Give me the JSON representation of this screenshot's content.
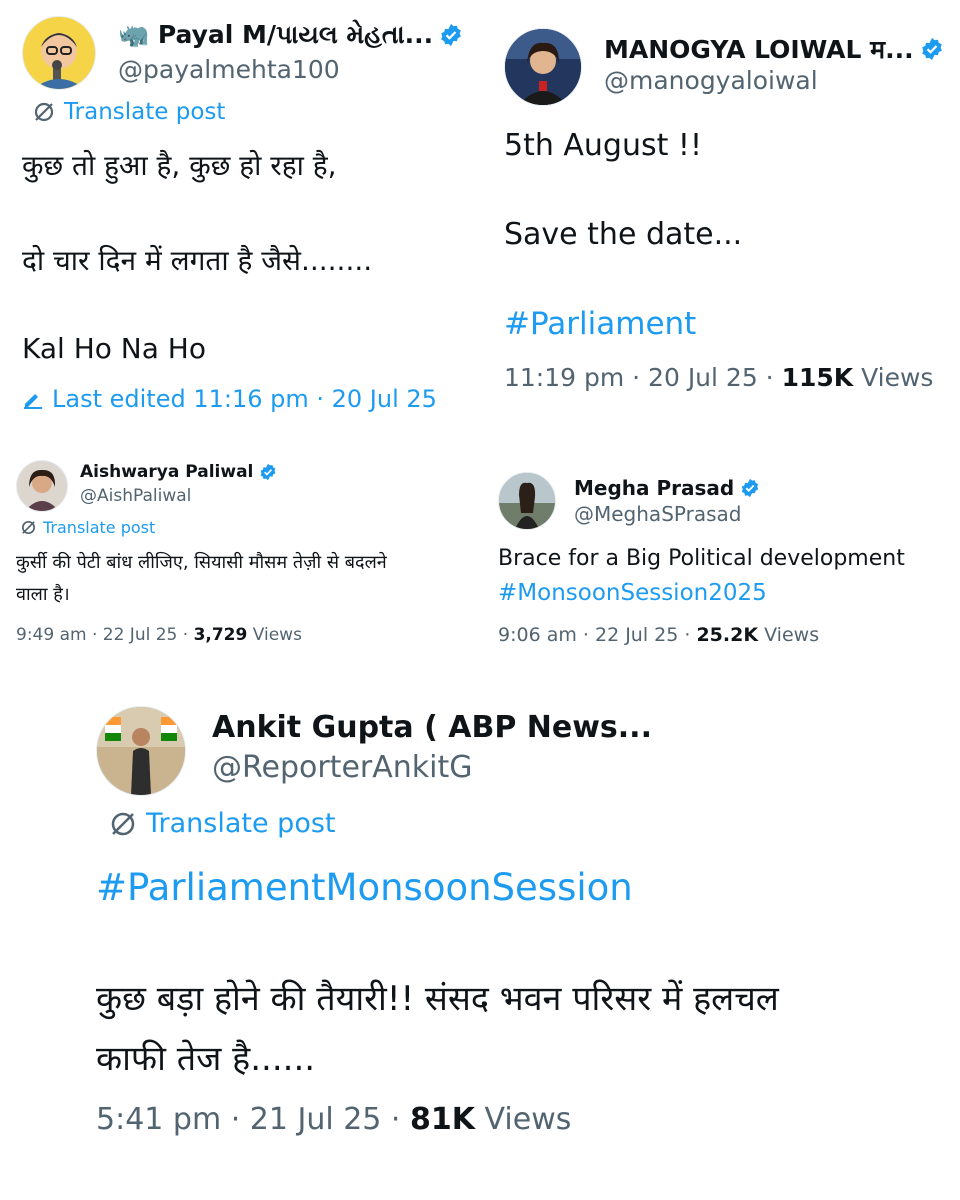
{
  "colors": {
    "link": "#1d9bf0",
    "text": "#0f1419",
    "muted": "#536471",
    "verified": "#1d9bf0"
  },
  "tweets": [
    {
      "name": "🦏 Payal M/પાયલ મેહતા...",
      "handle": "@payalmehta100",
      "translate": "Translate post",
      "lines": [
        "कुछ तो हुआ है, कुछ हो रहा है,",
        "दो चार दिन में लगता है जैसे........",
        "Kal Ho Na Ho"
      ],
      "edited": "Last edited 11:16 pm · 20 Jul 25",
      "icons": [
        "avatar-cartoon",
        "verified-badge-icon",
        "translate-icon",
        "edit-pencil-icon"
      ]
    },
    {
      "name": "MANOGYA LOIWAL म...",
      "handle": "@manogyaloiwal",
      "lines": [
        "5th August !!",
        "Save the date..."
      ],
      "hashtag": "#Parliament",
      "time": "11:19 pm · 20 Jul 25 · ",
      "views_count": "115K",
      "views_label": " Views"
    },
    {
      "name": "Aishwarya Paliwal",
      "handle": "@AishPaliwal",
      "translate": "Translate post",
      "lines": [
        "कुर्सी की पेटी बांध लीजिए, सियासी मौसम तेज़ी से बदलने",
        "वाला है।"
      ],
      "time": "9:49 am · 22 Jul 25 · ",
      "views_count": "3,729",
      "views_label": " Views"
    },
    {
      "name": "Megha Prasad",
      "handle": "@MeghaSPrasad",
      "lines": [
        "Brace for a Big Political development"
      ],
      "hashtag": "#MonsoonSession2025",
      "time": "9:06 am · 22 Jul 25 · ",
      "views_count": "25.2K",
      "views_label": " Views"
    },
    {
      "name": "Ankit Gupta ( ABP News...",
      "handle": "@ReporterAnkitG",
      "translate": "Translate post",
      "hashtag": "#ParliamentMonsoonSession",
      "lines": [
        " कुछ बड़ा होने की तैयारी!! संसद भवन परिसर में हलचल",
        "काफी तेज है......"
      ],
      "time": "5:41 pm · 21 Jul 25 · ",
      "views_count": "81K",
      "views_label": " Views"
    }
  ]
}
